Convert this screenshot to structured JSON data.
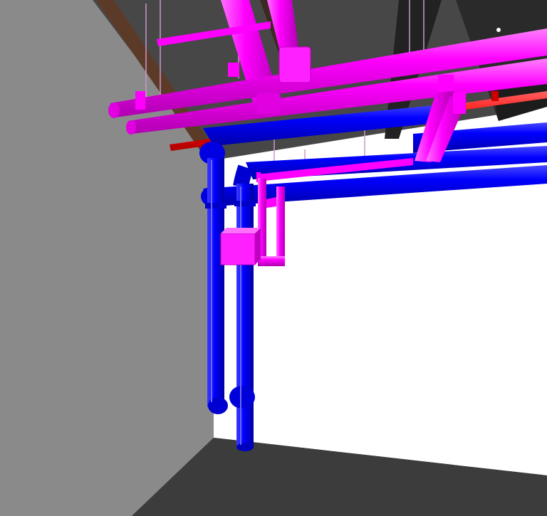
{
  "scene": {
    "description_hidden": "",
    "colors": {
      "left_wall": "#8a8a8a",
      "back_wall": "#ffffff",
      "floor": "#3b3b3b",
      "ceiling": "#4a4a4a",
      "beam": "#5a3a2a",
      "beam_dark": "#202020",
      "magenta_pipe": "#ff00ff",
      "magenta_shade": "#c000c0",
      "blue_pipe": "#0000ff",
      "blue_shade": "#0000b0",
      "red_pipe": "#ff0000",
      "hanger": "#d8b0d8"
    },
    "systems": [
      "magenta-pipe-system",
      "blue-pipe-system",
      "red-pipe-system"
    ]
  }
}
